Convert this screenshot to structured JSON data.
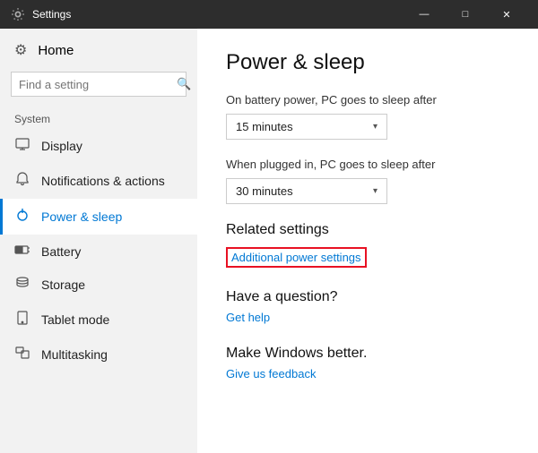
{
  "titleBar": {
    "title": "Settings",
    "minBtn": "—",
    "maxBtn": "□",
    "closeBtn": "✕"
  },
  "sidebar": {
    "home": "Home",
    "searchPlaceholder": "Find a setting",
    "sectionLabel": "System",
    "items": [
      {
        "id": "display",
        "label": "Display",
        "icon": "display"
      },
      {
        "id": "notifications",
        "label": "Notifications & actions",
        "icon": "bell"
      },
      {
        "id": "power",
        "label": "Power & sleep",
        "icon": "power",
        "active": true
      },
      {
        "id": "battery",
        "label": "Battery",
        "icon": "battery"
      },
      {
        "id": "storage",
        "label": "Storage",
        "icon": "storage"
      },
      {
        "id": "tablet",
        "label": "Tablet mode",
        "icon": "tablet"
      },
      {
        "id": "multitasking",
        "label": "Multitasking",
        "icon": "multi"
      }
    ]
  },
  "content": {
    "title": "Power & sleep",
    "batteryLabel": "On battery power, PC goes to sleep after",
    "batteryValue": "15 minutes",
    "pluggedLabel": "When plugged in, PC goes to sleep after",
    "pluggedValue": "30 minutes",
    "relatedTitle": "Related settings",
    "additionalLink": "Additional power settings",
    "questionTitle": "Have a question?",
    "helpLink": "Get help",
    "makeBetterTitle": "Make Windows better.",
    "feedbackLink": "Give us feedback"
  }
}
